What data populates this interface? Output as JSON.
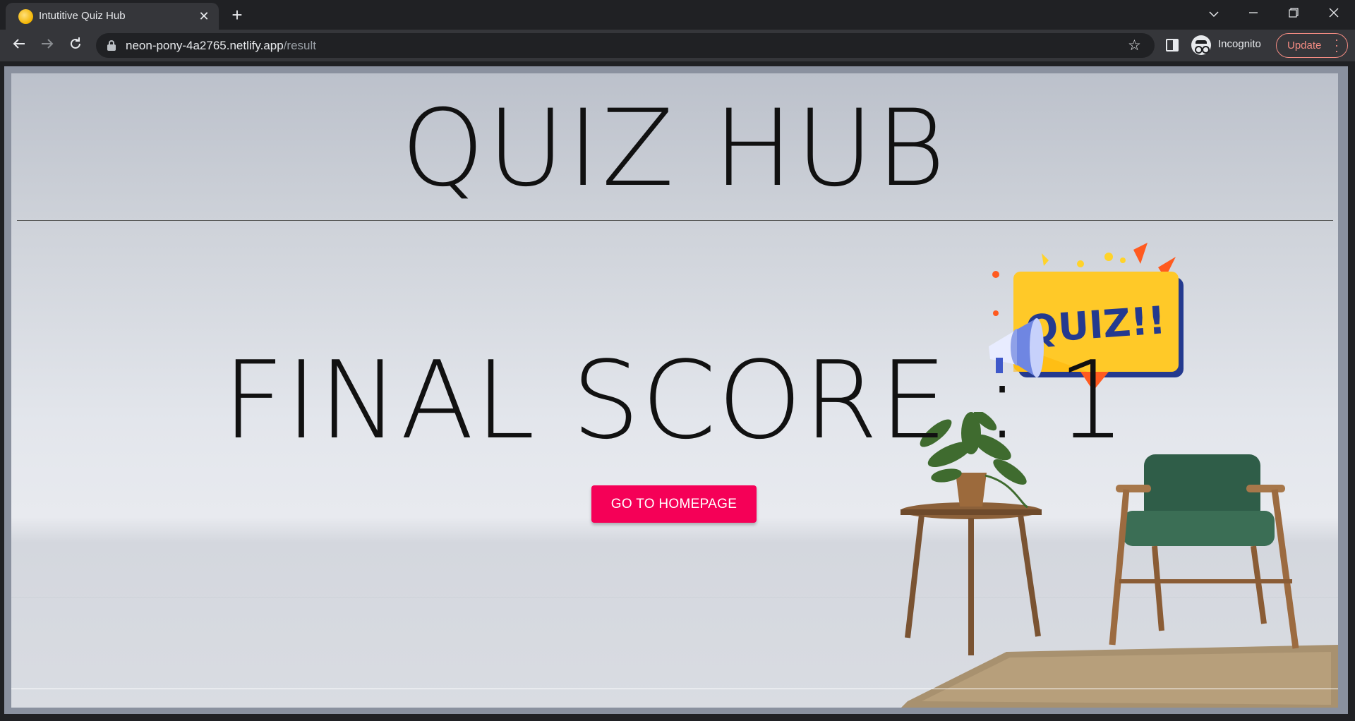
{
  "browser": {
    "tab_title": "Intutitive Quiz Hub",
    "url_host": "neon-pony-4a2765.netlify.app",
    "url_path": "/result",
    "profile_label": "Incognito",
    "update_label": "Update"
  },
  "page": {
    "title": "QUIZ HUB",
    "score_label": "FINAL SCORE : 1",
    "home_button_label": "GO TO HOMEPAGE",
    "badge_text": "QUIZ!!"
  },
  "colors": {
    "accent_button": "#f50057",
    "badge_yellow": "#ffc928",
    "badge_text": "#243a8f"
  },
  "icons": [
    "favicon",
    "close-icon",
    "plus-icon",
    "chevron-down-icon",
    "minimize-icon",
    "restore-icon",
    "window-close-icon",
    "back-icon",
    "forward-icon",
    "reload-icon",
    "lock-icon",
    "star-icon",
    "side-panel-icon",
    "incognito-icon",
    "more-icon",
    "megaphone-icon"
  ]
}
